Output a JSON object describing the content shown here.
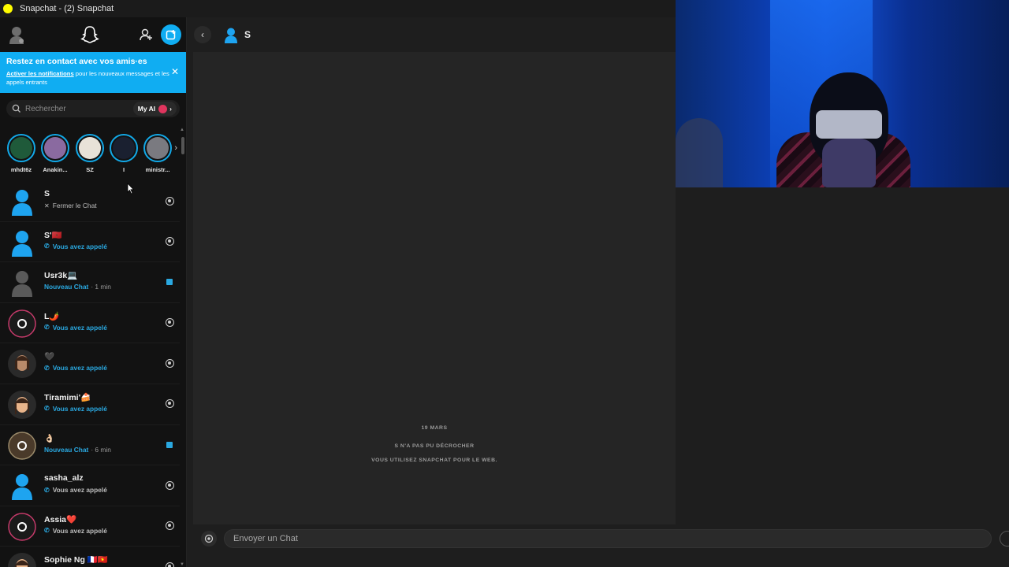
{
  "window": {
    "title": "Snapchat - (2) Snapchat"
  },
  "banner": {
    "title": "Restez en contact avec vos amis·es",
    "link": "Activer les notifications",
    "text": " pour les nouveaux messages et les appels entrants"
  },
  "search": {
    "placeholder": "Rechercher",
    "myai_label": "My AI"
  },
  "stories": [
    {
      "name": "mhdt6z",
      "color": "#1f5a3a"
    },
    {
      "name": "Anakin...",
      "color": "#8a6aa0"
    },
    {
      "name": "SZ",
      "color": "#e8e2d8"
    },
    {
      "name": "I",
      "color": "#1a2030"
    },
    {
      "name": "ministr...",
      "color": "#7a7a80"
    }
  ],
  "chats": [
    {
      "name": "S",
      "status": "Fermer le Chat",
      "status_type": "close",
      "avatar": "bitmoji-blue",
      "right": "camera-filled"
    },
    {
      "name": "S'🇲🇦",
      "status": "Vous avez appelé",
      "status_type": "called",
      "avatar": "bitmoji-blue",
      "right": "camera"
    },
    {
      "name": "Usr3k💻",
      "status": "Nouveau Chat",
      "time": "· 1 min",
      "status_type": "newchat",
      "avatar": "bitmoji-gray",
      "right": "chat"
    },
    {
      "name": "L🌶️",
      "status": "Vous avez appelé",
      "status_type": "called",
      "avatar": "ring-dark",
      "right": "camera"
    },
    {
      "name": "🖤",
      "status": "Vous avez appelé",
      "status_type": "called",
      "avatar": "bitmoji-hair",
      "right": "camera"
    },
    {
      "name": "Tiramimi'🍰",
      "status": "Vous avez appelé",
      "status_type": "called",
      "avatar": "bitmoji-girl",
      "right": "camera"
    },
    {
      "name": "👌🏻",
      "status": "Nouveau Chat",
      "time": "· 6 min",
      "status_type": "newchat",
      "avatar": "ring-photo",
      "right": "chat"
    },
    {
      "name": "sasha_alz",
      "status": "Vous avez appelé",
      "status_type": "called-gray",
      "avatar": "bitmoji-blue",
      "right": "camera"
    },
    {
      "name": "Assia❤️",
      "status": "Vous avez appelé",
      "status_type": "called-gray",
      "avatar": "ring-dark",
      "right": "camera"
    },
    {
      "name": "Sophie Ng 🇫🇷🇻🇳",
      "status": "",
      "status_type": "none",
      "avatar": "bitmoji-girl",
      "right": "camera"
    }
  ],
  "conversation": {
    "contact_name": "S",
    "date": "19 MARS",
    "msg1": "S N'A PAS PU DÉCROCHER",
    "msg2": "VOUS UTILISEZ SNAPCHAT POUR LE WEB."
  },
  "composer": {
    "placeholder": "Envoyer un Chat"
  },
  "colors": {
    "accent": "#10adf2",
    "snap_yellow": "#fffc00",
    "bg": "#121212"
  }
}
